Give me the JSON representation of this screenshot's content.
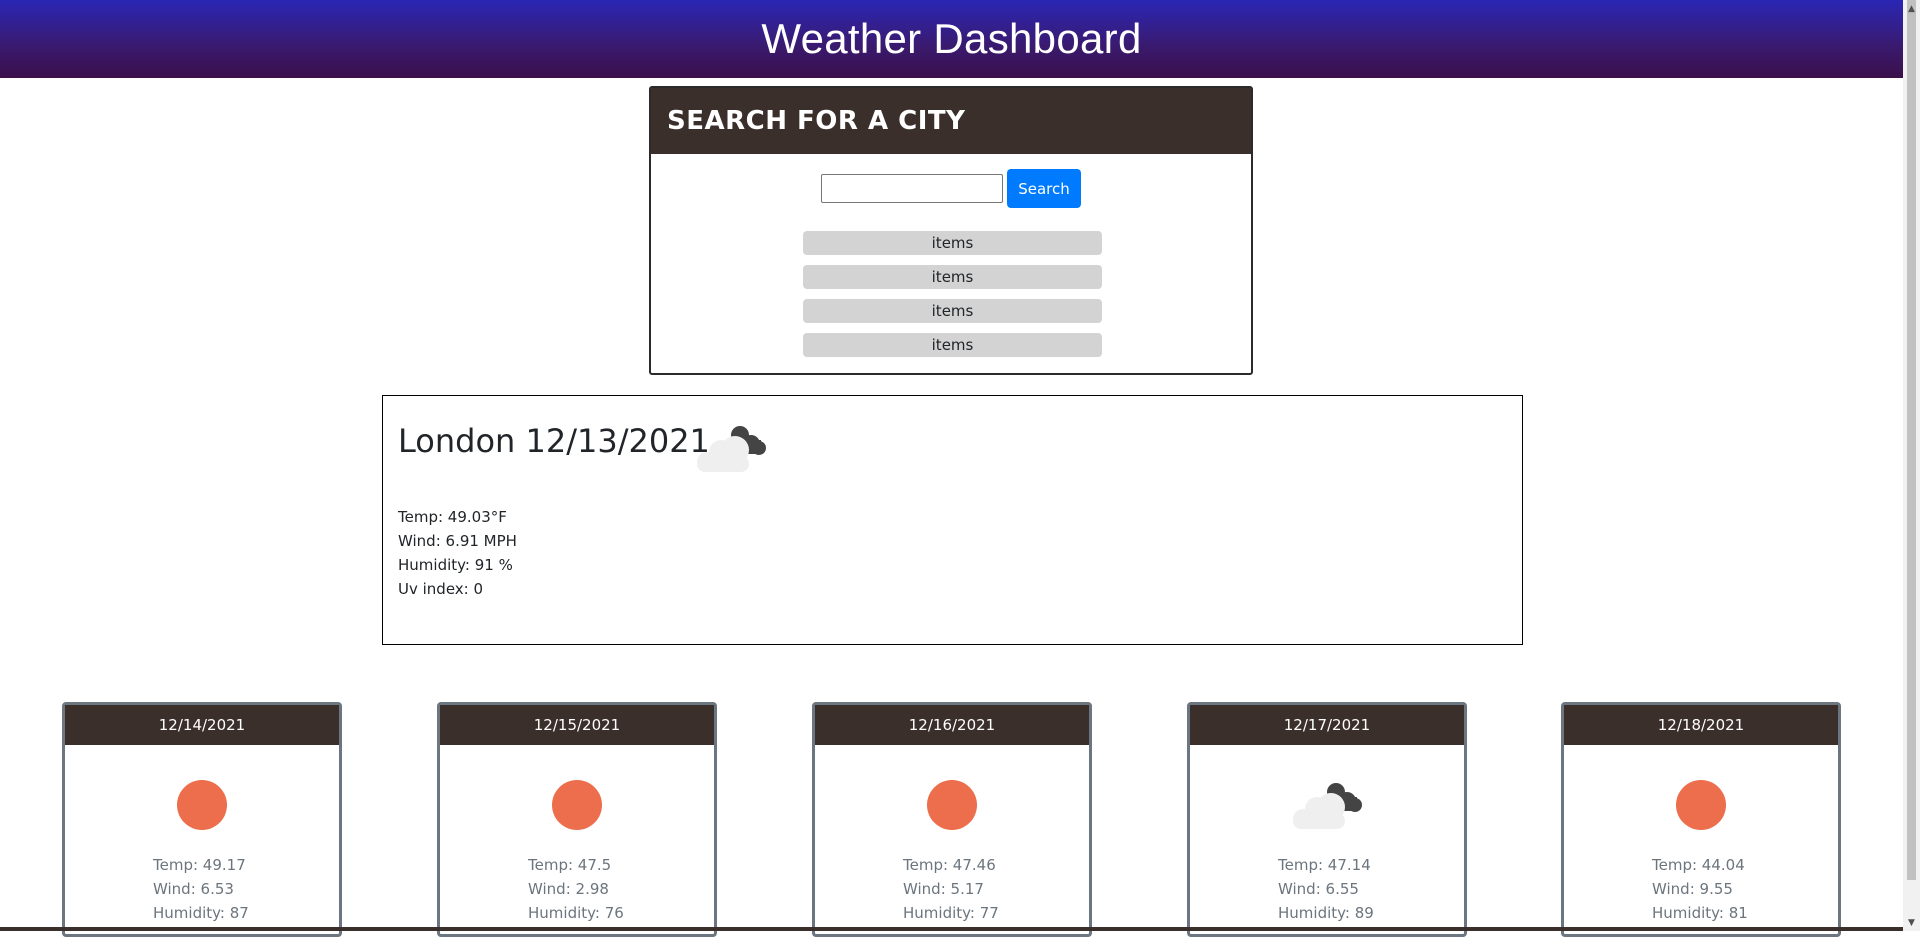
{
  "header": {
    "title": "Weather Dashboard"
  },
  "search": {
    "heading": "SEARCH FOR A CITY",
    "input_value": "",
    "button_label": "Search",
    "history": [
      "items",
      "items",
      "items",
      "items"
    ]
  },
  "current": {
    "title": "London 12/13/2021",
    "icon": "clouds-night-icon",
    "temp": "Temp: 49.03°F",
    "wind": "Wind: 6.91 MPH",
    "humidity": "Humidity: 91 %",
    "uv": "Uv index: 0"
  },
  "forecast": [
    {
      "date": "12/14/2021",
      "icon": "sun-icon",
      "temp": "Temp: 49.17",
      "wind": "Wind: 6.53",
      "humidity": "Humidity: 87"
    },
    {
      "date": "12/15/2021",
      "icon": "sun-icon",
      "temp": "Temp: 47.5",
      "wind": "Wind: 2.98",
      "humidity": "Humidity: 76"
    },
    {
      "date": "12/16/2021",
      "icon": "sun-icon",
      "temp": "Temp: 47.46",
      "wind": "Wind: 5.17",
      "humidity": "Humidity: 77"
    },
    {
      "date": "12/17/2021",
      "icon": "clouds-night-icon",
      "temp": "Temp: 47.14",
      "wind": "Wind: 6.55",
      "humidity": "Humidity: 89"
    },
    {
      "date": "12/18/2021",
      "icon": "sun-icon",
      "temp": "Temp: 44.04",
      "wind": "Wind: 9.55",
      "humidity": "Humidity: 81"
    }
  ],
  "colors": {
    "header_gradient_top": "#2a26b5",
    "header_gradient_bottom": "#3a0f4a",
    "panel_header": "#3b2f2c",
    "search_button": "#007bff",
    "sun": "#ec6e4c"
  }
}
